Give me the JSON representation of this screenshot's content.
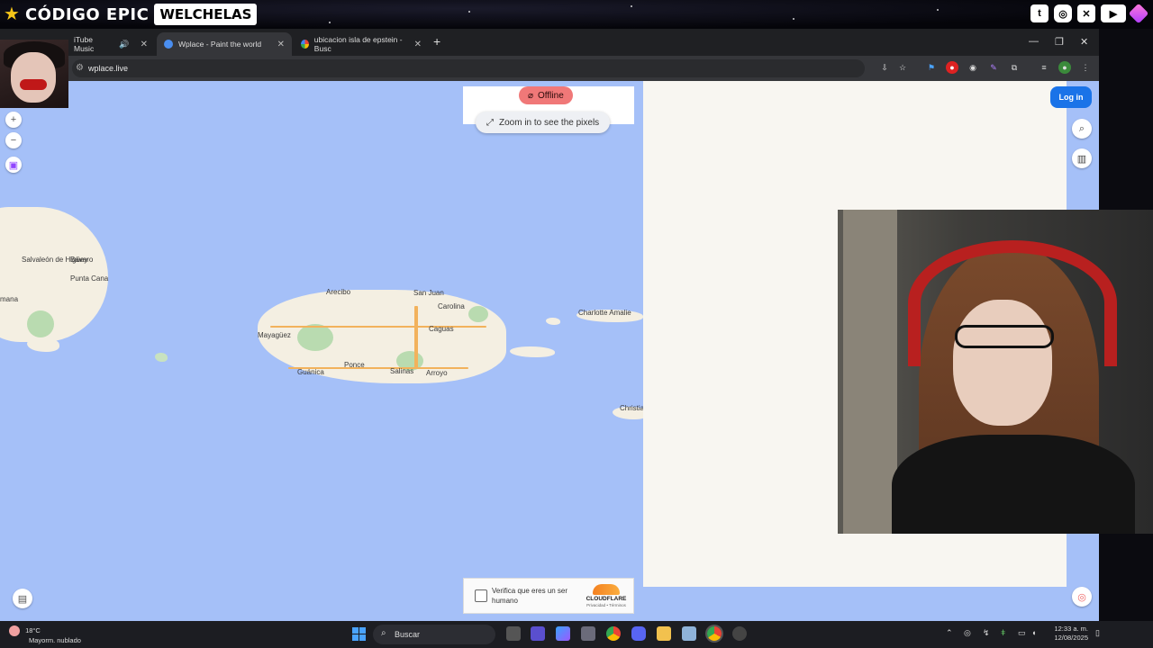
{
  "overlay": {
    "brand_text": "CÓDIGO EPIC",
    "brand_sub": "WELCHELAS",
    "socials": [
      "twitch-icon",
      "instagram-icon",
      "twitter-icon",
      "youtube-icon",
      "gem-icon"
    ]
  },
  "browser": {
    "tabs": [
      {
        "label": "iTube Music"
      },
      {
        "label": "Wplace - Paint the world"
      },
      {
        "label": "ubicacion isla de epstein - Busc"
      }
    ],
    "url": "wplace.live"
  },
  "map": {
    "offline_label": "Offline",
    "zoom_hint": "Zoom in to see the pixels",
    "login_label": "Log in",
    "cities": [
      {
        "name": "Salvaleón de Higüey"
      },
      {
        "name": "Bávaro"
      },
      {
        "name": "Punta Cana"
      },
      {
        "name": "mana"
      },
      {
        "name": "Arecibo"
      },
      {
        "name": "San Juan"
      },
      {
        "name": "Carolina"
      },
      {
        "name": "Mayagüez"
      },
      {
        "name": "Caguas"
      },
      {
        "name": "Ponce"
      },
      {
        "name": "Guánica"
      },
      {
        "name": "Salinas"
      },
      {
        "name": "Arroyo"
      },
      {
        "name": "Charlotte Amalie"
      },
      {
        "name": "Christiansted"
      }
    ]
  },
  "captcha": {
    "text": "Verifica que eres un ser humano",
    "brand": "CLOUDFLARE",
    "links": "Privacidad • Términos"
  },
  "taskbar": {
    "temp": "18°C",
    "weather": "Mayorm. nublado",
    "search_label": "Buscar",
    "time": "12:33 a. m.",
    "date": "12/08/2025"
  }
}
